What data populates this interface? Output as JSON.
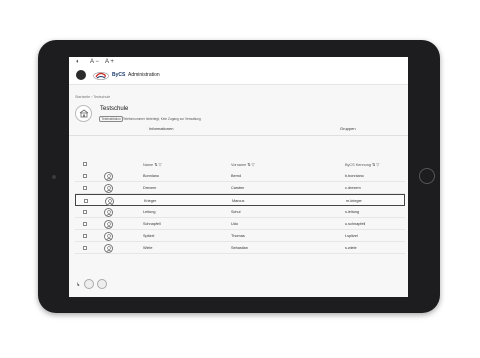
{
  "topbar": {
    "theme_icon": "◐",
    "font_decrease": "A −",
    "font_increase": "A +",
    "brand": "ByCS",
    "app_title": "Administration"
  },
  "breadcrumb": {
    "parent": "Startseite",
    "separator": "›",
    "current": "Testschule"
  },
  "school": {
    "title": "Testschule",
    "tag": "Testinstitution",
    "tagline": "Telefonnummer hinterlegt, Kein Zugang zur Verwaltung"
  },
  "tabs": [
    "Informationen",
    "Gruppen"
  ],
  "table": {
    "headers": {
      "name": "Name",
      "vorname": "Vorname",
      "kennung": "ByCS Kennung"
    },
    "rows": [
      {
        "name": "Bonnlano",
        "vorname": "Bernd",
        "kennung": "b.bonnlano"
      },
      {
        "name": "Drexem",
        "vorname": "Carsten",
        "kennung": "c.drexem"
      },
      {
        "name": "Krieger",
        "vorname": "Marcus",
        "kennung": "m.krieger"
      },
      {
        "name": "Leitung",
        "vorname": "Schul",
        "kennung": "s.leitung"
      },
      {
        "name": "Schnapfell",
        "vorname": "Udo",
        "kennung": "u.schnapfell"
      },
      {
        "name": "Spitzel",
        "vorname": "Thomas",
        "kennung": "t.spitzel"
      },
      {
        "name": "Wiele",
        "vorname": "Sebastian",
        "kennung": "s.wiele"
      }
    ],
    "selected_row": 2
  },
  "pager": {
    "arrow": "↳"
  },
  "colors": {
    "accent": "#1a3a6a",
    "frame": "#1d1d1f",
    "header_bg": "#ffffff",
    "content_bg": "#f7f7f7"
  }
}
